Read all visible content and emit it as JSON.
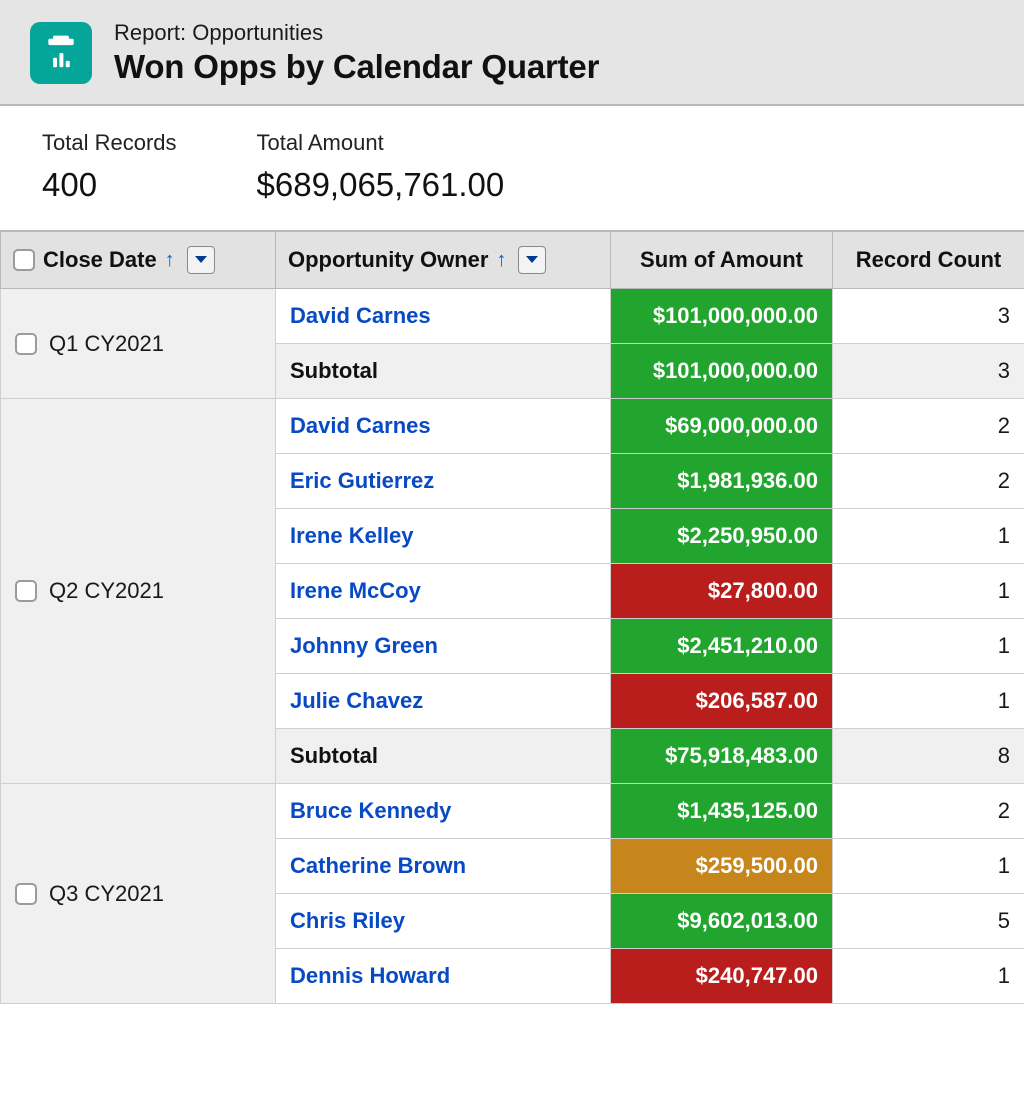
{
  "header": {
    "pretitle": "Report: Opportunities",
    "title": "Won Opps by Calendar Quarter"
  },
  "summary": {
    "records_label": "Total Records",
    "records_value": "400",
    "amount_label": "Total Amount",
    "amount_value": "$689,065,761.00"
  },
  "columns": {
    "close_date": "Close Date",
    "owner": "Opportunity Owner",
    "sum_amount": "Sum of Amount",
    "record_count": "Record Count"
  },
  "groups": [
    {
      "label": "Q1 CY2021",
      "rows": [
        {
          "owner": "David Carnes",
          "amount": "$101,000,000.00",
          "count": "3",
          "color": "green"
        }
      ],
      "subtotal": {
        "label": "Subtotal",
        "amount": "$101,000,000.00",
        "count": "3",
        "color": "green"
      }
    },
    {
      "label": "Q2 CY2021",
      "rows": [
        {
          "owner": "David Carnes",
          "amount": "$69,000,000.00",
          "count": "2",
          "color": "green"
        },
        {
          "owner": "Eric Gutierrez",
          "amount": "$1,981,936.00",
          "count": "2",
          "color": "green"
        },
        {
          "owner": "Irene Kelley",
          "amount": "$2,250,950.00",
          "count": "1",
          "color": "green"
        },
        {
          "owner": "Irene McCoy",
          "amount": "$27,800.00",
          "count": "1",
          "color": "red"
        },
        {
          "owner": "Johnny Green",
          "amount": "$2,451,210.00",
          "count": "1",
          "color": "green"
        },
        {
          "owner": "Julie Chavez",
          "amount": "$206,587.00",
          "count": "1",
          "color": "red"
        }
      ],
      "subtotal": {
        "label": "Subtotal",
        "amount": "$75,918,483.00",
        "count": "8",
        "color": "green"
      }
    },
    {
      "label": "Q3 CY2021",
      "rows": [
        {
          "owner": "Bruce Kennedy",
          "amount": "$1,435,125.00",
          "count": "2",
          "color": "green"
        },
        {
          "owner": "Catherine Brown",
          "amount": "$259,500.00",
          "count": "1",
          "color": "orange"
        },
        {
          "owner": "Chris Riley",
          "amount": "$9,602,013.00",
          "count": "5",
          "color": "green"
        },
        {
          "owner": "Dennis Howard",
          "amount": "$240,747.00",
          "count": "1",
          "color": "red"
        }
      ],
      "subtotal": null
    }
  ],
  "chart_data": {
    "type": "table",
    "title": "Won Opps by Calendar Quarter",
    "columns": [
      "Close Date",
      "Opportunity Owner",
      "Sum of Amount",
      "Record Count"
    ],
    "rows": [
      [
        "Q1 CY2021",
        "David Carnes",
        101000000.0,
        3
      ],
      [
        "Q1 CY2021",
        "Subtotal",
        101000000.0,
        3
      ],
      [
        "Q2 CY2021",
        "David Carnes",
        69000000.0,
        2
      ],
      [
        "Q2 CY2021",
        "Eric Gutierrez",
        1981936.0,
        2
      ],
      [
        "Q2 CY2021",
        "Irene Kelley",
        2250950.0,
        1
      ],
      [
        "Q2 CY2021",
        "Irene McCoy",
        27800.0,
        1
      ],
      [
        "Q2 CY2021",
        "Johnny Green",
        2451210.0,
        1
      ],
      [
        "Q2 CY2021",
        "Julie Chavez",
        206587.0,
        1
      ],
      [
        "Q2 CY2021",
        "Subtotal",
        75918483.0,
        8
      ],
      [
        "Q3 CY2021",
        "Bruce Kennedy",
        1435125.0,
        2
      ],
      [
        "Q3 CY2021",
        "Catherine Brown",
        259500.0,
        1
      ],
      [
        "Q3 CY2021",
        "Chris Riley",
        9602013.0,
        5
      ],
      [
        "Q3 CY2021",
        "Dennis Howard",
        240747.0,
        1
      ]
    ],
    "totals": {
      "Total Records": 400,
      "Total Amount": 689065761.0
    }
  }
}
